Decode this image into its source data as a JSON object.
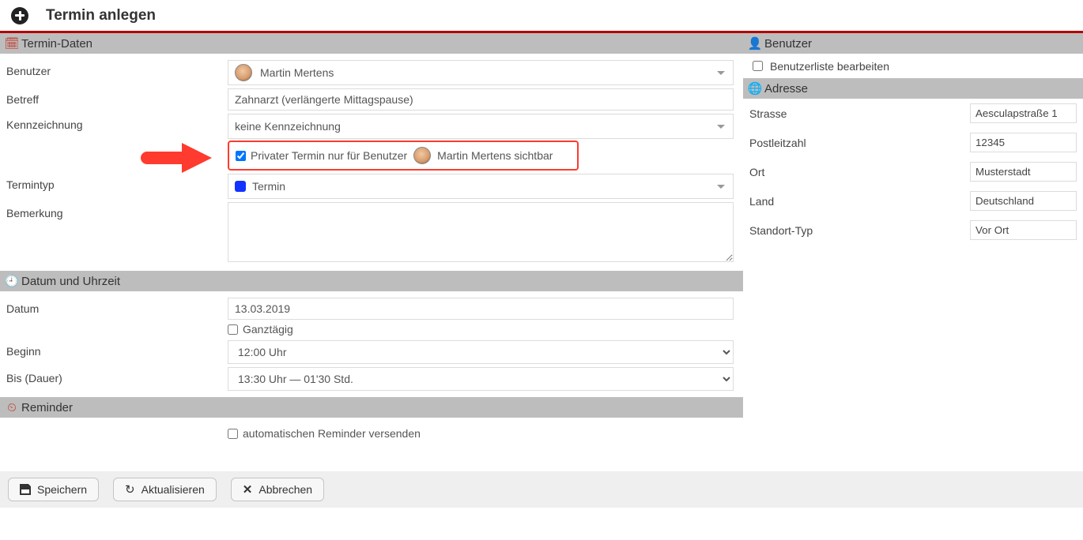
{
  "header": {
    "title": "Termin anlegen"
  },
  "sections": {
    "data": {
      "title": "Termin-Daten"
    },
    "datetime": {
      "title": "Datum und Uhrzeit"
    },
    "reminder": {
      "title": "Reminder"
    },
    "user": {
      "title": "Benutzer"
    },
    "address": {
      "title": "Adresse"
    }
  },
  "labels": {
    "benutzer": "Benutzer",
    "betreff": "Betreff",
    "kennzeichnung": "Kennzeichnung",
    "termintyp": "Termintyp",
    "bemerkung": "Bemerkung",
    "datum": "Datum",
    "beginn": "Beginn",
    "bis": "Bis (Dauer)",
    "ganztaegig": "Ganztägig",
    "auto_reminder": "automatischen Reminder versenden",
    "benutzerliste": "Benutzerliste bearbeiten",
    "strasse": "Strasse",
    "plz": "Postleitzahl",
    "ort": "Ort",
    "land": "Land",
    "standort": "Standort-Typ"
  },
  "values": {
    "benutzer_name": "Martin Mertens",
    "betreff": "Zahnarzt (verlängerte Mittagspause)",
    "kennzeichnung": "keine Kennzeichnung",
    "termintyp": "Termin",
    "bemerkung": "",
    "datum": "13.03.2019",
    "ganztaegig_checked": false,
    "beginn": "12:00 Uhr",
    "bis": "13:30 Uhr — 01'30 Std.",
    "auto_reminder_checked": false,
    "benutzerliste_checked": false,
    "private_checked": true,
    "private_text_pre": "Privater Termin nur für Benutzer",
    "private_text_post": "Martin Mertens sichtbar"
  },
  "address": {
    "strasse": "Aesculapstraße 1",
    "plz": "12345",
    "ort": "Musterstadt",
    "land": "Deutschland",
    "standort": "Vor Ort"
  },
  "buttons": {
    "save": "Speichern",
    "refresh": "Aktualisieren",
    "cancel": "Abbrechen"
  }
}
